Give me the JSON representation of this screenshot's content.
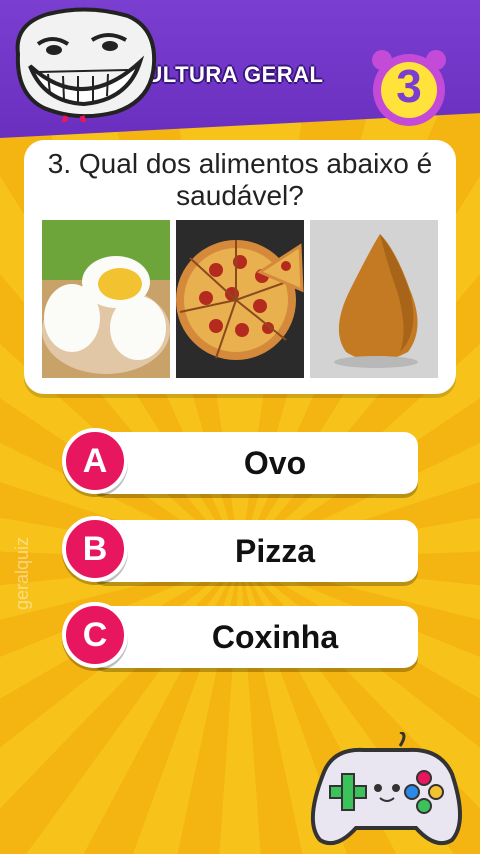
{
  "header": {
    "title": "CULTURA GERAL",
    "question_counter": "3"
  },
  "question": {
    "text": "3. Qual dos alimentos abaixo é saudável?"
  },
  "images": [
    {
      "icon": "boiled-eggs"
    },
    {
      "icon": "pepperoni-pizza"
    },
    {
      "icon": "coxinha"
    }
  ],
  "answers": [
    {
      "letter": "A",
      "label": "Ovo"
    },
    {
      "letter": "B",
      "label": "Pizza"
    },
    {
      "letter": "C",
      "label": "Coxinha"
    }
  ],
  "watermark": "geralquiz",
  "colors": {
    "header_purple": "#7a3fd0",
    "background_yellow": "#f7c21a",
    "badge_pink": "#e8165f"
  }
}
